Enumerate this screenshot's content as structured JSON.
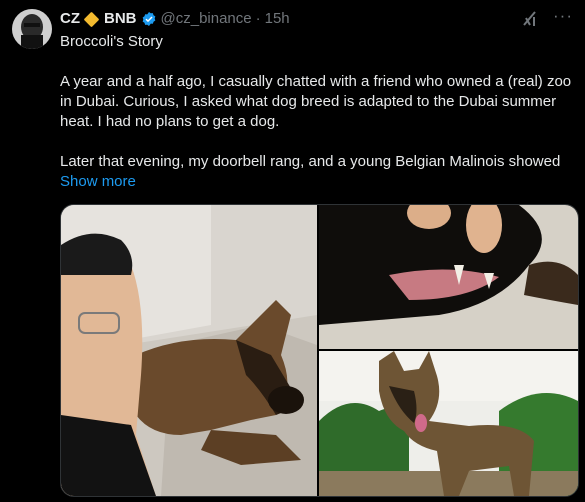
{
  "tweet": {
    "author_name": "CZ",
    "author_tag": "BNB",
    "handle": "@cz_binance",
    "separator": "·",
    "time": "15h",
    "more_label": "···",
    "title": "Broccoli's Story",
    "paragraph1": "A year and a half ago, I casually chatted with a friend who owned a (real) zoo in Dubai. Curious, I asked what dog breed is adapted to the Dubai summer heat. I had no plans to get a dog.",
    "paragraph2": "Later that evening, my doorbell rang, and a young Belgian Malinois showed",
    "show_more": "Show more"
  },
  "icons": {
    "badge": "diamond-icon",
    "verified": "verified-badge-icon",
    "grok": "grok-icon",
    "more": "more-options-icon"
  },
  "colors": {
    "background": "#000000",
    "text": "#e7e9ea",
    "muted": "#71767b",
    "link": "#1d9bf0",
    "bnb": "#f3ba2f"
  }
}
